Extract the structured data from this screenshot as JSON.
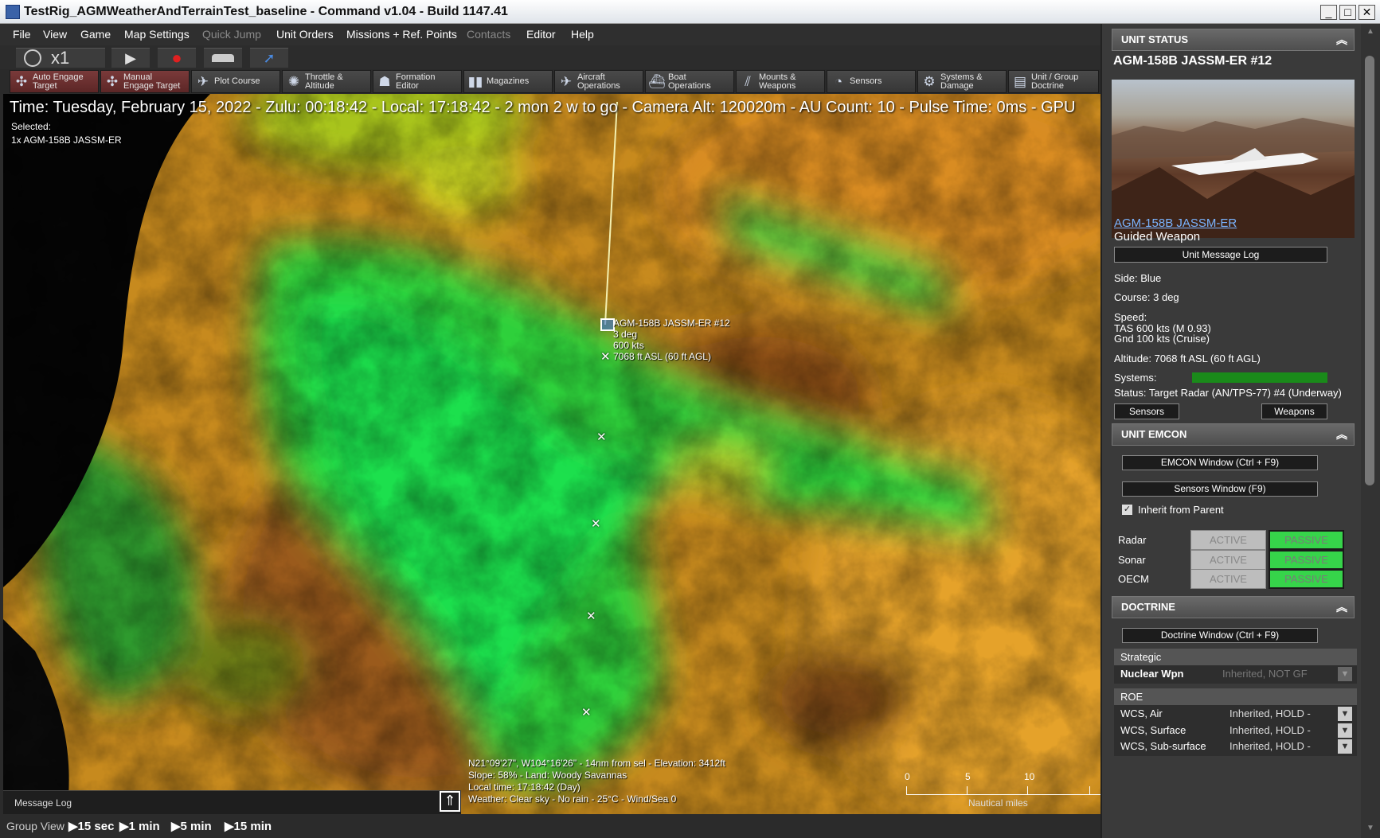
{
  "window": {
    "title": "TestRig_AGMWeatherAndTerrainTest_baseline - Command v1.04 - Build 1147.41",
    "min": "_",
    "max": "□",
    "close": "✕"
  },
  "menu": [
    "File",
    "View",
    "Game",
    "Map Settings",
    "Quick Jump",
    "Unit Orders",
    "Missions + Ref. Points",
    "Contacts",
    "Editor",
    "Help"
  ],
  "controls": {
    "speed": "x1",
    "play": "▶",
    "record": "●",
    "collapse_arrow": "▶"
  },
  "toolbar": [
    {
      "l1": "Auto Engage",
      "l2": "Target",
      "icon": "crosshair-icon"
    },
    {
      "l1": "Manual",
      "l2": "Engage Target",
      "icon": "crosshair-icon"
    },
    {
      "l1": "Plot Course",
      "l2": "",
      "icon": "plane-icon"
    },
    {
      "l1": "Throttle &",
      "l2": "Altitude",
      "icon": "gauge-icon"
    },
    {
      "l1": "Formation",
      "l2": "Editor",
      "icon": "group-icon"
    },
    {
      "l1": "Magazines",
      "l2": "",
      "icon": "ammo-icon"
    },
    {
      "l1": "Aircraft",
      "l2": "Operations",
      "icon": "aircraft-icon"
    },
    {
      "l1": "Boat",
      "l2": "Operations",
      "icon": "boat-icon"
    },
    {
      "l1": "Mounts &",
      "l2": "Weapons",
      "icon": "weapons-icon"
    },
    {
      "l1": "Sensors",
      "l2": "",
      "icon": "radar-icon"
    },
    {
      "l1": "Systems &",
      "l2": "Damage",
      "icon": "gear-icon"
    },
    {
      "l1": "Unit / Group",
      "l2": "Doctrine",
      "icon": "document-icon"
    }
  ],
  "map": {
    "status": "Time: Tuesday, February 15, 2022 - Zulu: 00:18:42 - Local: 17:18:42 - 2 mon 2 w to go - Camera Alt: 120020m - AU Count: 10 - Pulse Time: 0ms - GPU",
    "selected": "Selected:",
    "selected_unit": "1x AGM-158B JASSM-ER",
    "unit_label": {
      "name": "AGM-158B JASSM-ER #12",
      "course": "3 deg",
      "speed": "600 kts",
      "alt": "7068 ft ASL (60 ft AGL)"
    },
    "cursor": {
      "line1": "N21°09'27\", W104°16'26\" - 14nm from sel - Elevation: 3412ft",
      "line2": "Slope: 58% - Land: Woody Savannas",
      "line3": "Local time: 17:18:42 (Day)",
      "line4": "Weather: Clear sky - No rain - 25°C - Wind/Sea 0"
    },
    "scale": {
      "t0": "0",
      "t5": "5",
      "t10": "10",
      "unit": "Nautical miles"
    },
    "message_log": "Message Log"
  },
  "bottom": {
    "group_view": "Group View",
    "steps": [
      "15 sec",
      "1 min",
      "5 min",
      "15 min"
    ]
  },
  "unit_status": {
    "header": "UNIT STATUS",
    "name": "AGM-158B JASSM-ER #12",
    "link": "AGM-158B JASSM-ER",
    "type": "Guided Weapon",
    "msg_btn": "Unit Message Log",
    "side": "Side: Blue",
    "course": "Course: 3 deg",
    "speed_lbl": "Speed:",
    "tas": "TAS 600 kts (M 0.93)",
    "gnd": "Gnd 100 kts (Cruise)",
    "altitude": "Altitude: 7068 ft ASL (60 ft AGL)",
    "systems": "Systems:",
    "systems_health": 1.0,
    "status": "Status: Target Radar (AN/TPS-77) #4 (Underway)",
    "sensors_btn": "Sensors",
    "weapons_btn": "Weapons"
  },
  "emcon": {
    "header": "UNIT EMCON",
    "emcon_btn": "EMCON Window (Ctrl + F9)",
    "sensors_btn": "Sensors Window (F9)",
    "inherit": "Inherit from Parent",
    "rows": [
      {
        "name": "Radar",
        "active": "ACTIVE",
        "passive": "PASSIVE"
      },
      {
        "name": "Sonar",
        "active": "ACTIVE",
        "passive": "PASSIVE"
      },
      {
        "name": "OECM",
        "active": "ACTIVE",
        "passive": "PASSIVE"
      }
    ]
  },
  "doctrine": {
    "header": "DOCTRINE",
    "btn": "Doctrine Window (Ctrl + F9)",
    "strategic": "Strategic",
    "nuclear": {
      "label": "Nuclear Wpn",
      "value": "Inherited, NOT GF"
    },
    "roe": "ROE",
    "roe_rows": [
      {
        "label": "WCS, Air",
        "value": "Inherited, HOLD -"
      },
      {
        "label": "WCS, Surface",
        "value": "Inherited, HOLD -"
      },
      {
        "label": "WCS, Sub-surface",
        "value": "Inherited, HOLD -"
      }
    ]
  }
}
